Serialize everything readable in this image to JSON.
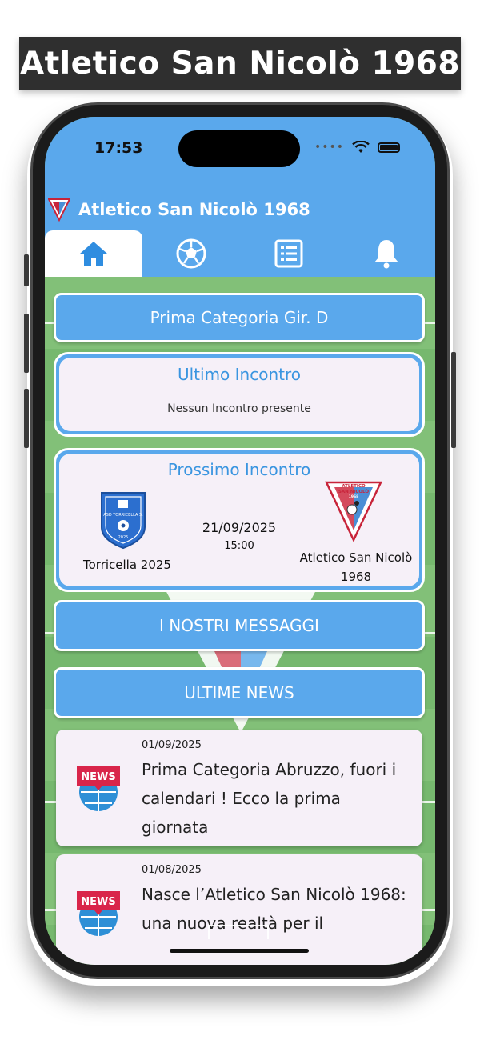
{
  "banner": {
    "title": "Atletico San Nicolò 1968"
  },
  "status_bar": {
    "time": "17:53"
  },
  "app_bar": {
    "title": "Atletico San Nicolò 1968"
  },
  "tabs": [
    {
      "name": "home",
      "icon": "home-icon",
      "active": true
    },
    {
      "name": "matches",
      "icon": "soccer-ball-icon",
      "active": false
    },
    {
      "name": "standings",
      "icon": "list-icon",
      "active": false
    },
    {
      "name": "notifications",
      "icon": "bell-icon",
      "active": false
    }
  ],
  "league": {
    "label": "Prima Categoria Gir. D"
  },
  "last_match": {
    "title": "Ultimo Incontro",
    "empty_text": "Nessun Incontro presente"
  },
  "next_match": {
    "title": "Prossimo Incontro",
    "home_team": "Torricella 2025",
    "away_team_line1": "Atletico San Nicolò",
    "away_team_line2": "1968",
    "date": "21/09/2025",
    "time": "15:00",
    "home_badge": {
      "name": "ASD TORRICELLA S.",
      "year": "2025"
    },
    "away_badge": {
      "line1": "ATLETICO",
      "line2": "SAN NICOLÒ",
      "line3": "1968"
    }
  },
  "messages": {
    "label": "I NOSTRI MESSAGGI"
  },
  "news_section": {
    "label": "ULTIME NEWS"
  },
  "news": [
    {
      "date": "01/09/2025",
      "title": "Prima Categoria Abruzzo, fuori i calendari ! Ecco la prima giornata",
      "badge": "NEWS"
    },
    {
      "date": "01/08/2025",
      "title": "Nasce l’Atletico San Nicolò 1968: una nuova realtà per il",
      "badge": "NEWS"
    }
  ],
  "colors": {
    "primary": "#5aa8ec",
    "field": "#76b86e",
    "card_bg": "#f6f0f8",
    "title_blue": "#3a95e0",
    "banner": "#2f2f2f"
  }
}
